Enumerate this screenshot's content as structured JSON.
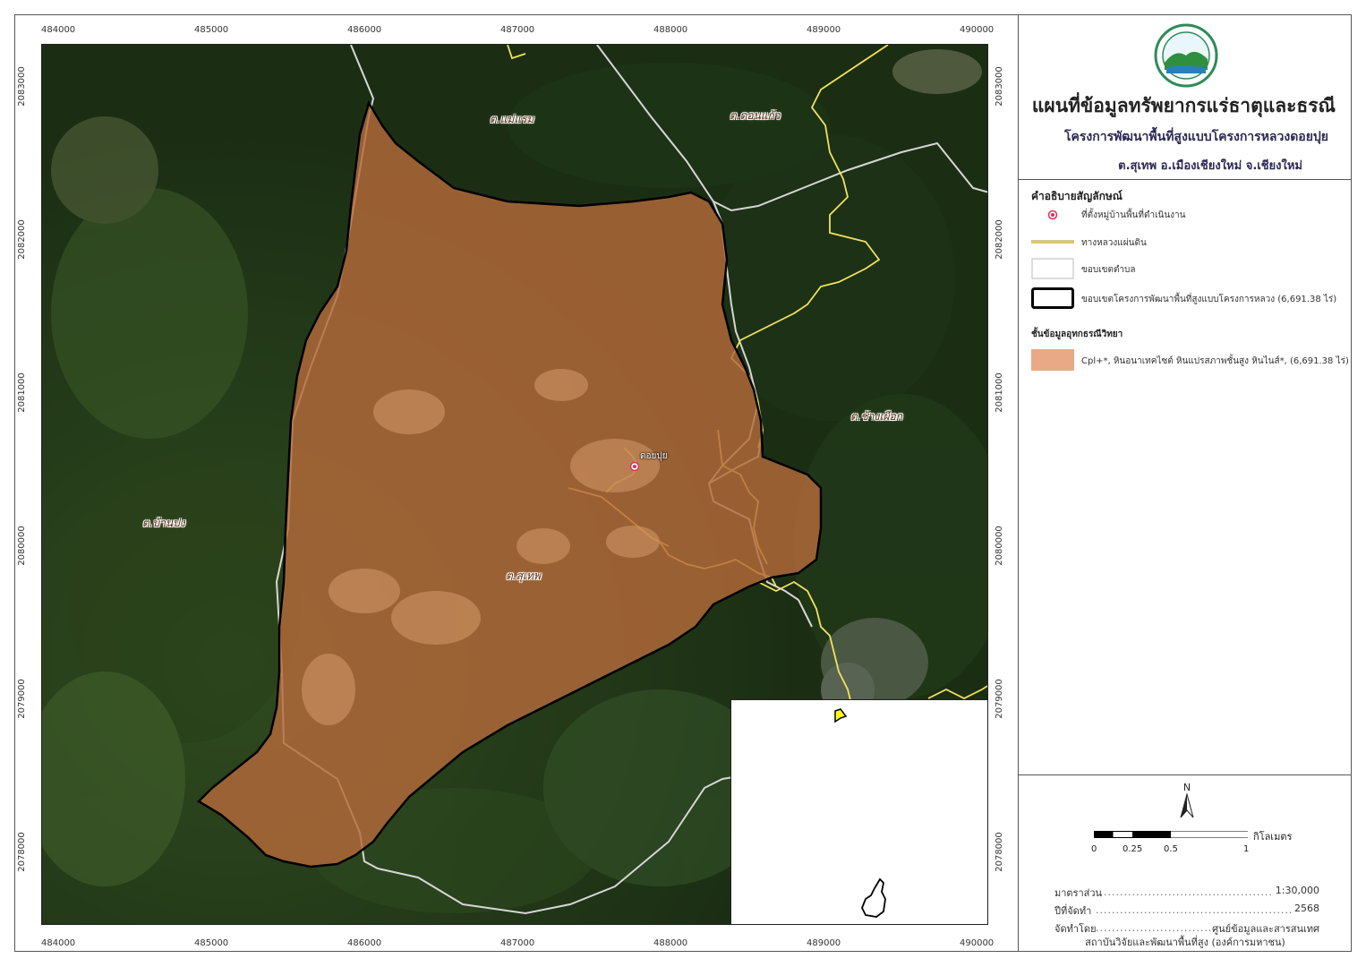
{
  "map": {
    "x_ticks": [
      "484000",
      "485000",
      "486000",
      "487000",
      "488000",
      "489000",
      "490000"
    ],
    "y_ticks": [
      "2083000",
      "2082000",
      "2081000",
      "2080000",
      "2079000",
      "2078000"
    ],
    "place_labels": {
      "mae_raem": "ต.แม่แรม",
      "don_kaeo": "ต.ดอนแก้ว",
      "chang_phueak": "ต.ช้างเผือก",
      "ban_pong": "ต.บ้านปง",
      "suthep": "ต.สุเทพ"
    },
    "village_label": "ดอยปุย"
  },
  "title": {
    "main": "แผนที่ข้อมูลทรัพยากรแร่ธาตุและธรณี",
    "project": "โครงการพัฒนาพื้นที่สูงแบบโครงการหลวงดอยปุย",
    "location": "ต.สุเทพ อ.เมืองเชียงใหม่ จ.เชียงใหม่"
  },
  "legend": {
    "heading": "คำอธิบายสัญลักษณ์",
    "village": "ที่ตั้งหมู่บ้านพื้นที่ดำเนินงาน",
    "highway": "ทางหลวงแผ่นดิน",
    "subdistrict_boundary": "ขอบเขตตำบล",
    "project_boundary": "ขอบเขตโครงการพัฒนาพื้นที่สูงแบบโครงการหลวง (6,691.38 ไร่)",
    "geology_heading": "ชั้นข้อมูลอุทกธรณีวิทยา",
    "geology_unit": "Cpl+*, หินอนาเทคไซต์ หินแปรสภาพชั้นสูง หินไนส์*, (6,691.38 ไร่)"
  },
  "colors": {
    "project_fill": "#b56a3a",
    "highway": "#f3e25a",
    "boundary": "#d8d8d8",
    "geology_swatch": "#e9a987",
    "village_marker": "#e0305a",
    "inset_highlight": "#ffff00"
  },
  "north_label": "N",
  "scale": {
    "unit": "กิโลเมตร",
    "labels": [
      "0",
      "0.25",
      "0.5",
      "1"
    ]
  },
  "meta": {
    "scale_key": "มาตราส่วน",
    "scale_value": "1:30,000",
    "year_key": "ปีที่จัดทำ",
    "year_value": "2568",
    "by_key": "จัดทำโดย",
    "by_value": "ศูนย์ข้อมูลและสารสนเทศ",
    "org": "สถาบันวิจัยและพัฒนาพื้นที่สูง (องค์การมหาชน)"
  }
}
